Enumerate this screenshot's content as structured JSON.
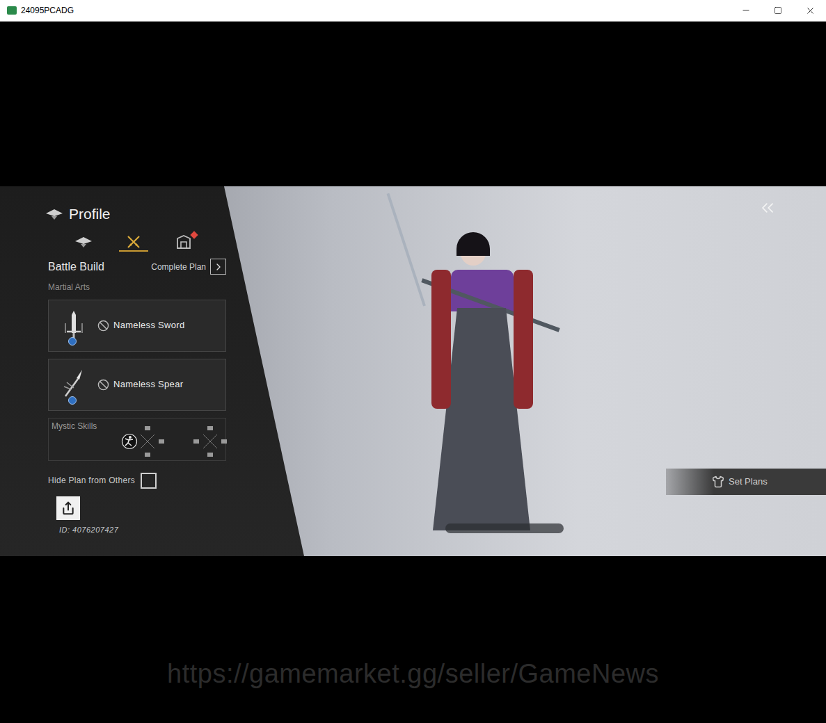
{
  "window": {
    "title": "24095PCADG"
  },
  "profile": {
    "title": "Profile",
    "tabs": [
      {
        "kind": "emblem",
        "selected": false,
        "badge": false
      },
      {
        "kind": "swords",
        "selected": true,
        "badge": false
      },
      {
        "kind": "gate",
        "selected": false,
        "badge": true
      }
    ]
  },
  "battle_build": {
    "title": "Battle Build",
    "complete_plan": "Complete Plan"
  },
  "martial_arts": {
    "label": "Martial Arts",
    "items": [
      {
        "name": "Nameless Sword",
        "kind": "sword"
      },
      {
        "name": "Nameless Spear",
        "kind": "spear"
      }
    ]
  },
  "mystic_skills": {
    "label": "Mystic Skills",
    "groups": [
      {
        "equipped": true
      },
      {
        "equipped": false
      }
    ]
  },
  "hide_plan": {
    "label": "Hide Plan from Others",
    "checked": false
  },
  "player_id": "ID: 4076207427",
  "set_plans": "Set Plans",
  "watermark": "https://gamemarket.gg/seller/GameNews"
}
